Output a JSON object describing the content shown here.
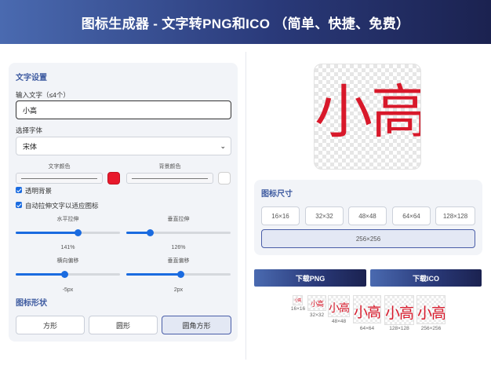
{
  "header": {
    "title": "图标生成器 - 文字转PNG和ICO （简单、快捷、免费）"
  },
  "text_settings": {
    "section_title": "文字设置",
    "input_label": "输入文字（≤4个）",
    "input_value": "小高",
    "font_label": "选择字体",
    "font_value": "宋体",
    "text_color_label": "文字颜色",
    "text_color": "#e8192c",
    "bg_color_label": "背景颜色",
    "bg_color": "#ffffff",
    "transparent_bg_label": "透明背景",
    "transparent_bg_checked": true,
    "stretch_label": "自动拉伸文字以适应图标",
    "stretch_checked": true,
    "h_stretch_label": "水平拉伸",
    "h_stretch_value": "141%",
    "h_stretch_level": 0.6,
    "v_stretch_label": "垂直拉伸",
    "v_stretch_value": "126%",
    "v_stretch_level": 0.23,
    "h_offset_label": "横向偏移",
    "h_offset_value": "-5px",
    "h_offset_level": 0.47,
    "v_offset_label": "垂直偏移",
    "v_offset_value": "2px",
    "v_offset_level": 0.52
  },
  "shape": {
    "section_title": "图标形状",
    "options": [
      "方形",
      "圆形",
      "圆角方形"
    ],
    "selected": "圆角方形"
  },
  "preview": {
    "text": "小高",
    "color": "#d8182a"
  },
  "sizes": {
    "section_title": "图标尺寸",
    "options": [
      "16×16",
      "32×32",
      "48×48",
      "64×64",
      "128×128",
      "256×256"
    ],
    "selected": "256×256"
  },
  "download": {
    "png_label": "下载PNG",
    "ico_label": "下载ICO"
  },
  "thumbnails": [
    "16×16",
    "32×32",
    "48×48",
    "64×64",
    "128×128",
    "256×256"
  ],
  "colors": {
    "accent": "#1a6be0",
    "title_blue": "#3d5aa0",
    "header_dark": "#1b2250"
  }
}
